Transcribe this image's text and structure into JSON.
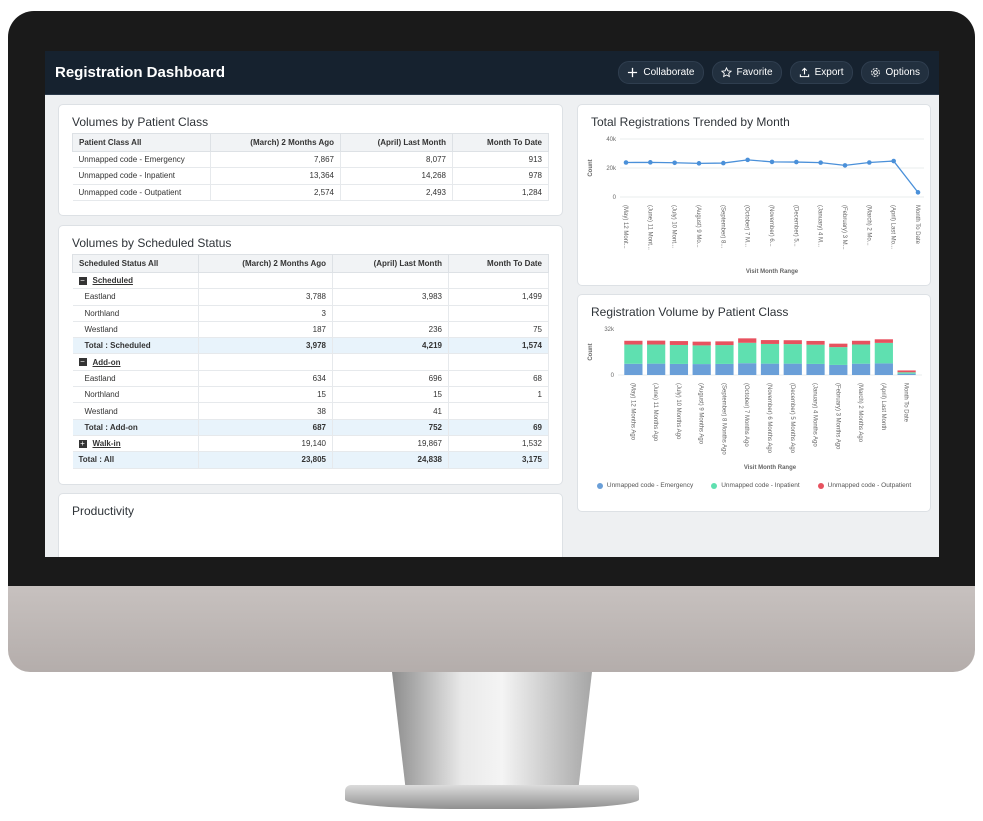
{
  "app": {
    "title": "Registration Dashboard",
    "buttons": {
      "collaborate": "Collaborate",
      "favorite": "Favorite",
      "export": "Export",
      "options": "Options"
    }
  },
  "patient_class": {
    "title": "Volumes by Patient Class",
    "headers": [
      "Patient Class All",
      "(March) 2 Months Ago",
      "(April) Last Month",
      "Month To Date"
    ],
    "rows": [
      [
        "Unmapped code - Emergency",
        "7,867",
        "8,077",
        "913"
      ],
      [
        "Unmapped code - Inpatient",
        "13,364",
        "14,268",
        "978"
      ],
      [
        "Unmapped code - Outpatient",
        "2,574",
        "2,493",
        "1,284"
      ]
    ]
  },
  "scheduled_status": {
    "title": "Volumes by Scheduled Status",
    "headers": [
      "Scheduled Status All",
      "(March) 2 Months Ago",
      "(April) Last Month",
      "Month To Date"
    ],
    "groups": [
      {
        "toggle": "−",
        "label": "Scheduled",
        "rows": [
          [
            "Eastland",
            "3,788",
            "3,983",
            "1,499"
          ],
          [
            "Northland",
            "3",
            "",
            ""
          ],
          [
            "Westland",
            "187",
            "236",
            "75"
          ]
        ],
        "total": [
          "Total : Scheduled",
          "3,978",
          "4,219",
          "1,574"
        ]
      },
      {
        "toggle": "−",
        "label": "Add-on",
        "rows": [
          [
            "Eastland",
            "634",
            "696",
            "68"
          ],
          [
            "Northland",
            "15",
            "15",
            "1"
          ],
          [
            "Westland",
            "38",
            "41",
            ""
          ]
        ],
        "total": [
          "Total : Add-on",
          "687",
          "752",
          "69"
        ]
      }
    ],
    "walkin": {
      "toggle": "+",
      "label": "Walk-in",
      "values": [
        "19,140",
        "19,867",
        "1,532"
      ]
    },
    "grand_total": [
      "Total : All",
      "23,805",
      "24,838",
      "3,175"
    ]
  },
  "productivity": {
    "title": "Productivity"
  },
  "chart_data": [
    {
      "type": "line",
      "title": "Total Registrations Trended by Month",
      "xlabel": "Visit Month Range",
      "ylabel": "Count",
      "y_ticks": [
        "40k",
        "20k",
        "0"
      ],
      "ylim": [
        0,
        40000
      ],
      "categories": [
        "(May) 12 Mont...",
        "(June) 11 Mont...",
        "(July) 10 Mont...",
        "(August) 9 Mo...",
        "(September) 8...",
        "(October) 7 M...",
        "(November) 6...",
        "(December) 5...",
        "(January) 4 M...",
        "(February) 3 M...",
        "(March) 2 Mo...",
        "(April) Last Mo...",
        "Month To Date"
      ],
      "values": [
        23800,
        23900,
        23600,
        23200,
        23400,
        25600,
        24200,
        24100,
        23700,
        21800,
        23800,
        24800,
        3200
      ],
      "color": "#4a90d9"
    },
    {
      "type": "bar",
      "stacked": true,
      "title": "Registration Volume by Patient Class",
      "xlabel": "Visit Month Range",
      "ylabel": "Count",
      "y_ticks": [
        "32k",
        "0"
      ],
      "ylim": [
        0,
        32000
      ],
      "categories": [
        "(May) 12 Months Ago",
        "(June) 11 Months Ago",
        "(July) 10 Months Ago",
        "(August) 9 Months Ago",
        "(September) 8 Months Ago",
        "(October) 7 Months Ago",
        "(November) 6 Months Ago",
        "(December) 5 Months Ago",
        "(January) 4 Months Ago",
        "(February) 3 Months Ago",
        "(March) 2 Months Ago",
        "(April) Last Month",
        "Month To Date"
      ],
      "series": [
        {
          "name": "Unmapped code - Emergency",
          "color": "#6a9fd8",
          "values": [
            7800,
            7900,
            7700,
            7600,
            7700,
            8200,
            7900,
            7900,
            7700,
            7000,
            7867,
            8077,
            913
          ]
        },
        {
          "name": "Unmapped code - Inpatient",
          "color": "#5fe0b0",
          "values": [
            13400,
            13300,
            13200,
            13000,
            13100,
            14200,
            13700,
            13600,
            13400,
            12400,
            13364,
            14268,
            978
          ]
        },
        {
          "name": "Unmapped code - Outpatient",
          "color": "#e7525f",
          "values": [
            2600,
            2700,
            2700,
            2600,
            2600,
            3100,
            2700,
            2700,
            2600,
            2400,
            2574,
            2493,
            1284
          ]
        }
      ]
    }
  ]
}
